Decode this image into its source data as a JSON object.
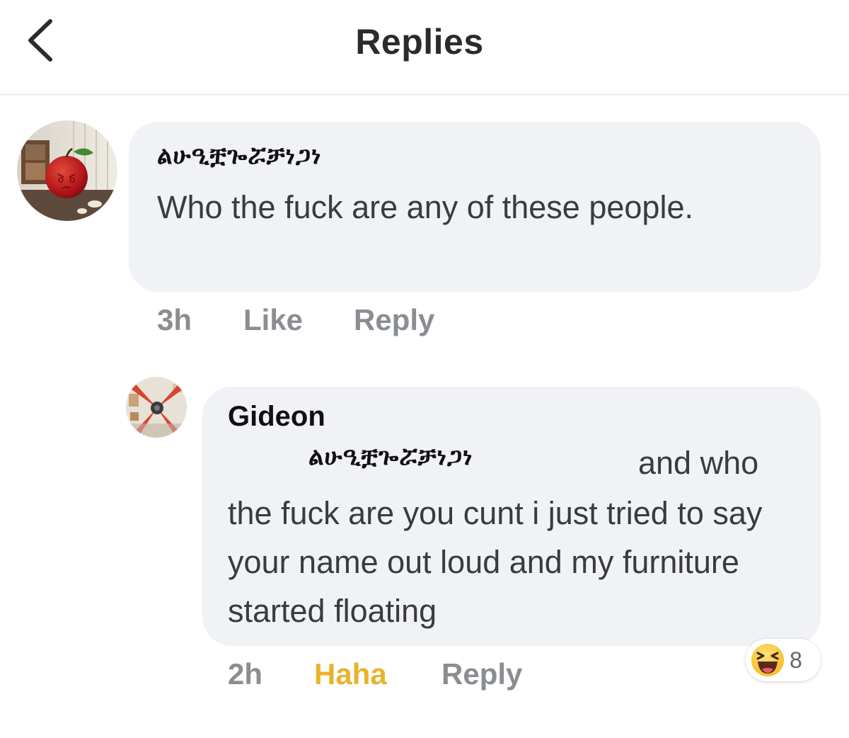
{
  "header": {
    "title": "Replies",
    "back_icon": "chevron-left-icon"
  },
  "comments": [
    {
      "author": "ልሁዒቿጐሯቻነጋነ",
      "text": "Who the fuck are any of these people.",
      "time": "3h",
      "like_label": "Like",
      "reply_label": "Reply",
      "avatar_icon": "apple-avatar"
    },
    {
      "author": "Gideon",
      "mention": "ልሁዒቿጐሯቻነጋነ",
      "text_first": "and who",
      "text_rest": "the fuck are you cunt i just tried to say your name out loud and my furniture started floating",
      "time": "2h",
      "reaction_label": "Haha",
      "reply_label": "Reply",
      "reaction_count": "8",
      "reaction_icon": "haha-emoji-icon",
      "avatar_icon": "fan-avatar"
    }
  ],
  "colors": {
    "bubble": "#f0f2f5",
    "meta_gray": "#8a8d91",
    "haha_yellow": "#e8b32b"
  }
}
